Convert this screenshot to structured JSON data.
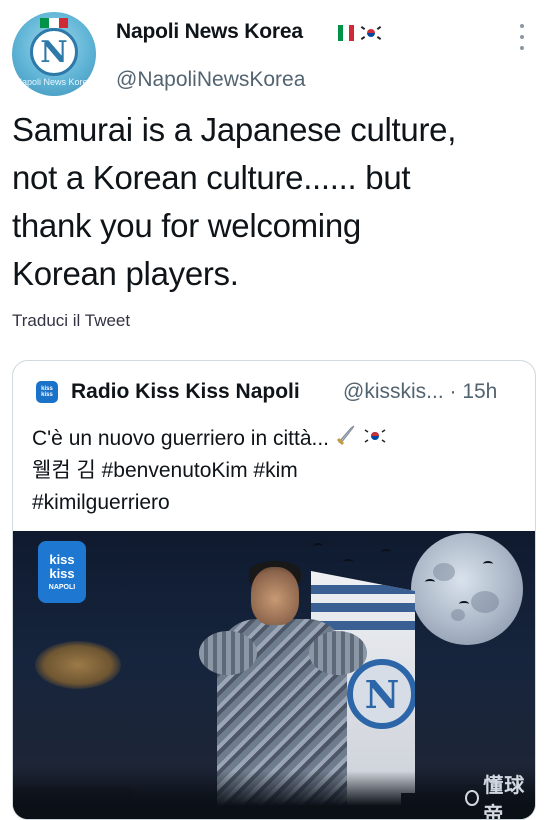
{
  "author": {
    "name": "Napoli News Korea",
    "handle": "@NapoliNewsKorea",
    "avatar_text": "N",
    "avatar_watermark": "Napoli News Korea",
    "name_flags": [
      "italy-flag",
      "south-korea-flag"
    ]
  },
  "tweet": {
    "lines": [
      "Samurai is a Japanese culture,",
      "not a Korean culture...... but",
      "thank you for welcoming",
      "Korean players."
    ],
    "translate_label": "Traduci il Tweet"
  },
  "quoted": {
    "name": "Radio Kiss Kiss Napoli",
    "handle": "@kisskis... · 15h",
    "line1": "C'è un nuovo guerriero in città...",
    "line1_icons": [
      "sword-icon",
      "south-korea-flag"
    ],
    "line2": "웰컴 김 #benvenutoKim #kim",
    "line3": "#kimilguerriero",
    "image": {
      "logo_lines": [
        "kiss",
        "kiss",
        "NAPOLI"
      ],
      "crest_text": "N",
      "watermark": "懂球帝"
    }
  },
  "colors": {
    "text": "#0f1419",
    "secondary": "#536471",
    "border": "#cfd9de",
    "italy_green": "#009246",
    "italy_red": "#ce2b37",
    "korea_red": "#cd2e3a",
    "korea_blue": "#0047a0",
    "kiss_blue": "#1e78d2"
  }
}
